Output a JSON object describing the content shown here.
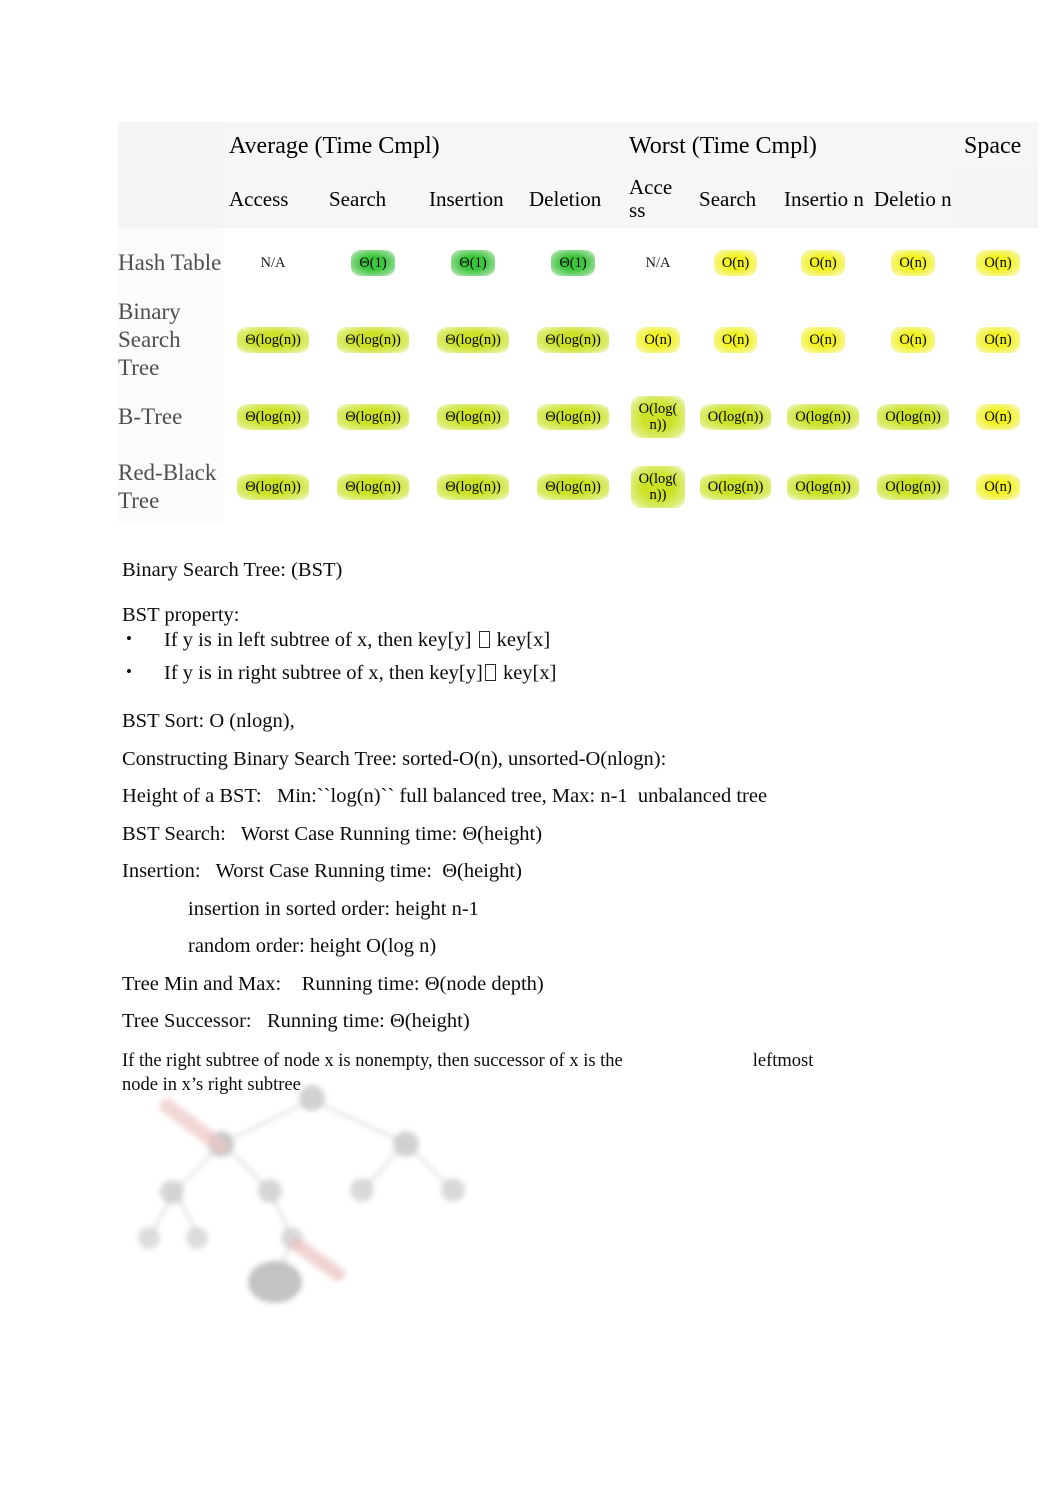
{
  "table": {
    "group_headers": [
      {
        "label": "",
        "span": 1
      },
      {
        "label": "Average (Time Cmpl)",
        "span": 4
      },
      {
        "label": "Worst (Time Cmpl)",
        "span": 4
      },
      {
        "label": "Space",
        "span": 1
      }
    ],
    "column_headers": [
      "",
      "Access",
      "Search",
      "Insertion",
      "Deletion",
      "Acce ss",
      "Search",
      "Insertio n",
      "Deletio n",
      ""
    ],
    "rows": [
      {
        "label": "Hash Table",
        "cells": [
          {
            "text": "N/A",
            "style": "plain"
          },
          {
            "text": "Θ(1)",
            "style": "green"
          },
          {
            "text": "Θ(1)",
            "style": "green"
          },
          {
            "text": "Θ(1)",
            "style": "green"
          },
          {
            "text": "N/A",
            "style": "plain"
          },
          {
            "text": "O(n)",
            "style": "yellow"
          },
          {
            "text": "O(n)",
            "style": "yellow"
          },
          {
            "text": "O(n)",
            "style": "yellow"
          },
          {
            "text": "O(n)",
            "style": "yellow"
          }
        ]
      },
      {
        "label": "Binary Search Tree",
        "cells": [
          {
            "text": "Θ(log(n))",
            "style": "yellowgreen"
          },
          {
            "text": "Θ(log(n))",
            "style": "yellowgreen"
          },
          {
            "text": "Θ(log(n))",
            "style": "yellowgreen"
          },
          {
            "text": "Θ(log(n))",
            "style": "yellowgreen"
          },
          {
            "text": "O(n)",
            "style": "yellow"
          },
          {
            "text": "O(n)",
            "style": "yellow"
          },
          {
            "text": "O(n)",
            "style": "yellow"
          },
          {
            "text": "O(n)",
            "style": "yellow"
          },
          {
            "text": "O(n)",
            "style": "yellow"
          }
        ]
      },
      {
        "label": "B-Tree",
        "cells": [
          {
            "text": "Θ(log(n))",
            "style": "yellowgreen"
          },
          {
            "text": "Θ(log(n))",
            "style": "yellowgreen"
          },
          {
            "text": "Θ(log(n))",
            "style": "yellowgreen"
          },
          {
            "text": "Θ(log(n))",
            "style": "yellowgreen"
          },
          {
            "text": "O(log(\nn))",
            "style": "yellowgreen"
          },
          {
            "text": "O(log(n))",
            "style": "yellowgreen"
          },
          {
            "text": "O(log(n))",
            "style": "yellowgreen"
          },
          {
            "text": "O(log(n))",
            "style": "yellowgreen"
          },
          {
            "text": "O(n)",
            "style": "yellow"
          }
        ]
      },
      {
        "label": "Red-Black Tree",
        "cells": [
          {
            "text": "Θ(log(n))",
            "style": "yellowgreen"
          },
          {
            "text": "Θ(log(n))",
            "style": "yellowgreen"
          },
          {
            "text": "Θ(log(n))",
            "style": "yellowgreen"
          },
          {
            "text": "Θ(log(n))",
            "style": "yellowgreen"
          },
          {
            "text": "O(log(\nn))",
            "style": "yellowgreen"
          },
          {
            "text": "O(log(n))",
            "style": "yellowgreen"
          },
          {
            "text": "O(log(n))",
            "style": "yellowgreen"
          },
          {
            "text": "O(log(n))",
            "style": "yellowgreen"
          },
          {
            "text": "O(n)",
            "style": "yellow"
          }
        ]
      }
    ],
    "colors": {
      "green": "#3cc63c",
      "yellow_green": "#cbe226",
      "yellow": "#f2f222",
      "row_label": "#4f4f4f",
      "header_bg": "#f6f6f6"
    }
  },
  "notes": {
    "heading": "Binary Search Tree: (BST)",
    "property_title": "BST property:",
    "bullets": [
      {
        "prefix": "If y is in left subtree of x, then key[y] ",
        "suffix": " key[x]"
      },
      {
        "prefix": "If y is in right subtree of x, then key[y]",
        "suffix": " key[x]"
      }
    ],
    "bullet_glyph": "•",
    "lines": [
      "BST Sort: O (nlogn),",
      "Constructing Binary Search Tree: sorted-O(n), unsorted-O(nlogn):",
      "Height of a BST:   Min:``log(n)`` full balanced tree, Max: n-1  unbalanced tree",
      "BST Search:   Worst Case Running time: Θ(height)",
      "Insertion:   Worst Case Running time:  Θ(height)"
    ],
    "indented": [
      "insertion in sorted order: height n-1",
      "random order: height O(log n)"
    ],
    "lines2": [
      "Tree Min and Max:    Running time: Θ(node depth)",
      "Tree Successor:   Running time: Θ(height)"
    ],
    "successor_note_a": "If the right subtree of node x is nonempty, then successor of x is the",
    "successor_note_b": "leftmost",
    "successor_note_c": "node in x’s right subtree"
  },
  "figure": {
    "caption": "binary-search-tree-successor-diagram"
  }
}
